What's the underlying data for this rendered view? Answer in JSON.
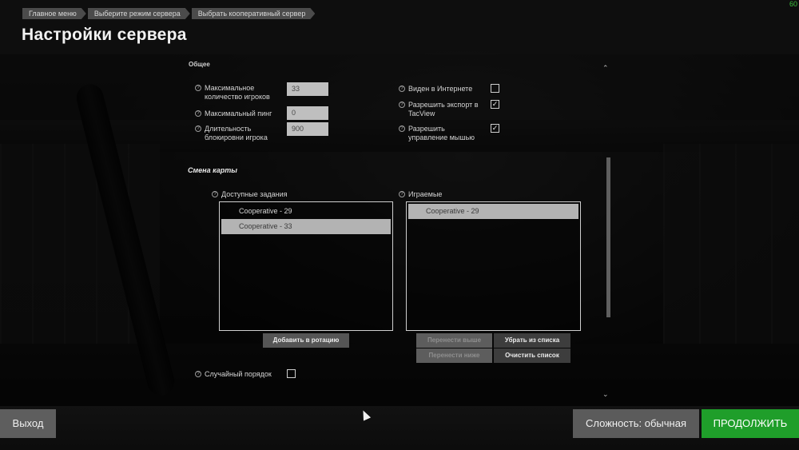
{
  "header": {
    "breadcrumbs": [
      "Главное меню",
      "Выберите режим сервера",
      "Выбрать кооперативный сервер"
    ],
    "title": "Настройки сервера",
    "fps": "60"
  },
  "general": {
    "cutoff_label": "Общее",
    "max_players": {
      "label_line1": "Максимальное",
      "label_line2": "количество игроков",
      "value": "33"
    },
    "max_ping": {
      "label": "Максимальный пинг",
      "value": "0"
    },
    "block_duration": {
      "label_line1": "Длительность",
      "label_line2": "блокировни игрока",
      "value": "900"
    },
    "visible_internet": {
      "label": "Виден в Интернете",
      "checked": false
    },
    "allow_tacview": {
      "label_line1": "Разрешить экспорт в",
      "label_line2": "TacView",
      "checked": true
    },
    "allow_mouse": {
      "label_line1": "Разрешить",
      "label_line2": "управление мышью",
      "checked": true
    }
  },
  "map_change": {
    "title": "Смена карты",
    "available": {
      "label": "Доступные задания",
      "items": [
        {
          "label": "Cooperative - 29",
          "selected": false
        },
        {
          "label": "Cooperative - 33",
          "selected": true
        }
      ],
      "add_button": "Добавить в ротацию"
    },
    "playable": {
      "label": "Играемые",
      "items": [
        {
          "label": "Cooperative - 29",
          "selected": true
        }
      ],
      "move_up": "Перенести выше",
      "remove": "Убрать из списка",
      "move_down": "Перенести ниже",
      "clear": "Очистить список"
    },
    "random_order": {
      "label": "Случайный порядок",
      "checked": false
    }
  },
  "footer": {
    "exit": "Выход",
    "difficulty": "Сложность: обычная",
    "continue": "ПРОДОЛЖИТЬ"
  },
  "icons": {
    "help": "?",
    "check": "✓",
    "scroll_up": "⌃",
    "scroll_down": "⌄"
  },
  "colors": {
    "continue_bg": "#1f9e2a",
    "fps_text": "#3ec13e"
  }
}
